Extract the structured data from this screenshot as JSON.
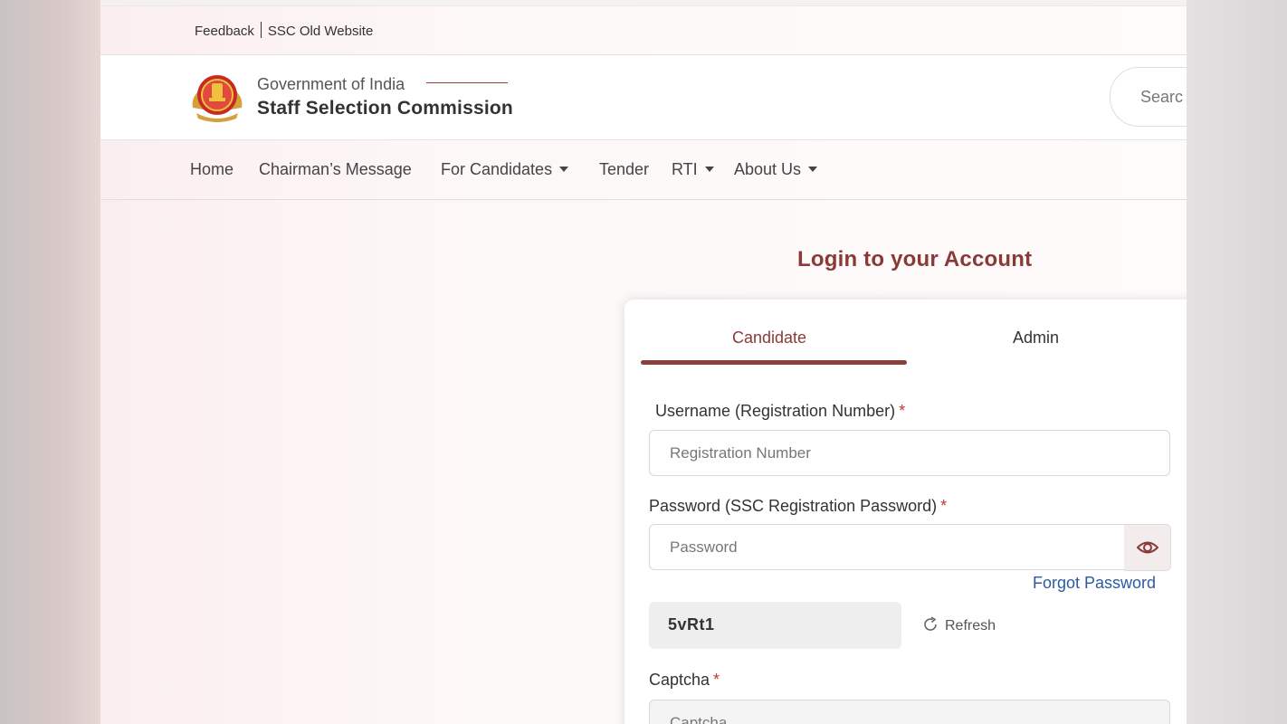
{
  "utility": {
    "feedback": "Feedback",
    "old_website": "SSC Old Website"
  },
  "header": {
    "gov_title": "Government of India",
    "org_title": "Staff Selection Commission",
    "search_placeholder": "Searc",
    "emblem_icon": "ssc-emblem-icon"
  },
  "nav": {
    "items": [
      {
        "label": "Home",
        "has_dropdown": false
      },
      {
        "label": "Chairman’s Message",
        "has_dropdown": false
      },
      {
        "label": "For Candidates",
        "has_dropdown": true
      },
      {
        "label": "Tender",
        "has_dropdown": false
      },
      {
        "label": "RTI",
        "has_dropdown": true
      },
      {
        "label": "About Us",
        "has_dropdown": true
      }
    ]
  },
  "login": {
    "title": "Login to your Account",
    "tabs": [
      {
        "label": "Candidate",
        "active": true
      },
      {
        "label": "Admin",
        "active": false
      }
    ],
    "username_label": "Username (Registration Number)",
    "username_placeholder": "Registration Number",
    "password_label": "Password (SSC Registration Password)",
    "password_placeholder": "Password",
    "required_mark": "*",
    "forgot_password": "Forgot Password",
    "captcha_code": "5vRt1",
    "refresh_label": "Refresh",
    "captcha_label": "Captcha",
    "captcha_placeholder": "Captcha",
    "show_password_icon": "eye-icon",
    "refresh_icon": "refresh-icon"
  },
  "colors": {
    "accent": "#8a3a36",
    "link": "#2c5aa0",
    "required": "#c0392b"
  }
}
